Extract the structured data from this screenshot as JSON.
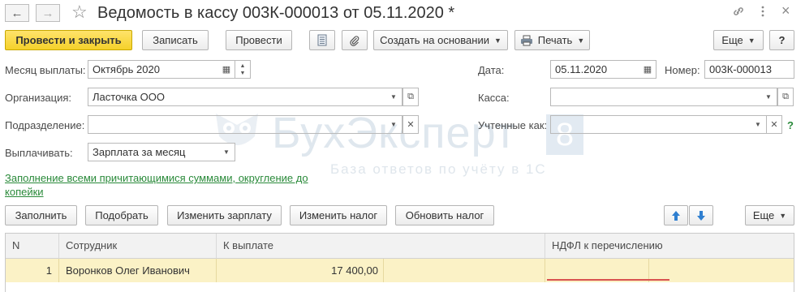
{
  "window": {
    "title": "Ведомость в кассу 003К-000013 от 05.11.2020 *",
    "back_icon": "arrow-left-icon",
    "forward_icon": "arrow-right-icon",
    "favorite_icon": "star-icon",
    "link_icon": "chain-link-icon",
    "more_icon": "vertical-dots-icon",
    "close_label": "×"
  },
  "toolbar": {
    "post_close_label": "Провести и закрыть",
    "save_label": "Записать",
    "post_label": "Провести",
    "create_based_label": "Создать на основании",
    "print_label": "Печать",
    "more_label": "Еще",
    "help_label": "?"
  },
  "form": {
    "month_label": "Месяц выплаты:",
    "month_value": "Октябрь 2020",
    "date_label": "Дата:",
    "date_value": "05.11.2020",
    "number_label": "Номер:",
    "number_value": "003К-000013",
    "org_label": "Организация:",
    "org_value": "Ласточка ООО",
    "kassa_label": "Касса:",
    "kassa_value": "",
    "dept_label": "Подразделение:",
    "dept_value": "",
    "accounted_label": "Учтенные как:",
    "accounted_value": "",
    "accounted_help": "?",
    "pay_label": "Выплачивать:",
    "pay_value": "Зарплата за месяц",
    "fill_link": "Заполнение всеми причитающимися суммами, округление до копейки"
  },
  "watermark": {
    "brand": "БухЭксперт",
    "version": "8",
    "tagline": "База ответов по учёту в 1С"
  },
  "table_toolbar": {
    "fill_label": "Заполнить",
    "select_label": "Подобрать",
    "change_salary_label": "Изменить зарплату",
    "change_tax_label": "Изменить налог",
    "update_tax_label": "Обновить налог",
    "more_label": "Еще"
  },
  "table": {
    "columns": [
      "N",
      "Сотрудник",
      "К выплате",
      "НДФЛ к перечислению"
    ],
    "rows": [
      {
        "n": "1",
        "employee": "Воронков Олег Иванович",
        "amount": "17 400,00",
        "ndfl": ""
      }
    ]
  },
  "colors": {
    "primary_button": "#f5d12a",
    "link": "#2a8a3a",
    "selected_row": "#fbf2c6",
    "error_underline": "#d9534f"
  }
}
